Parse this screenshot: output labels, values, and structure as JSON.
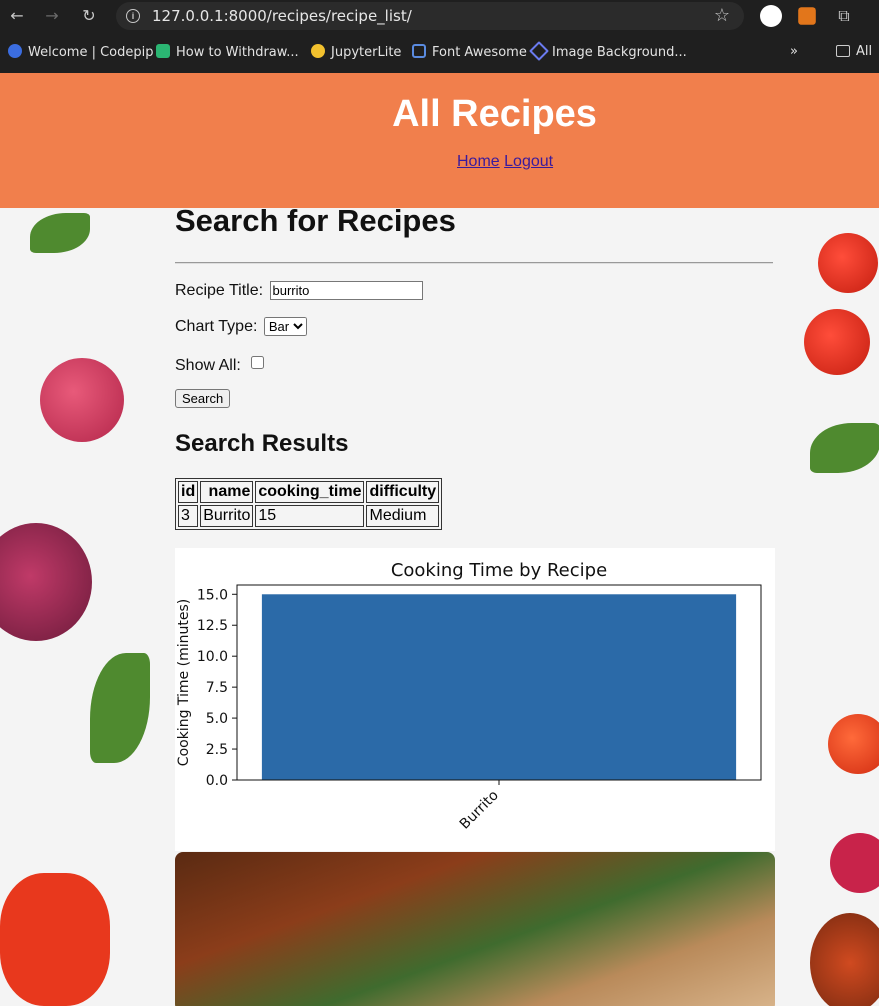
{
  "browser": {
    "url": "127.0.0.1:8000/recipes/recipe_list/",
    "bookmarks": [
      "Welcome | Codepip",
      "How to Withdraw...",
      "JupyterLite",
      "Font Awesome",
      "Image Background...",
      "All"
    ]
  },
  "header": {
    "title": "All Recipes",
    "home_link": "Home",
    "logout_link": "Logout"
  },
  "search": {
    "heading": "Search for Recipes",
    "title_label": "Recipe Title:",
    "title_value": "burrito",
    "chart_type_label": "Chart Type:",
    "chart_type_value": "Bar",
    "show_all_label": "Show All:",
    "button_label": "Search"
  },
  "results": {
    "heading": "Search Results",
    "columns": [
      "id",
      "name",
      "cooking_time",
      "difficulty"
    ],
    "rows": [
      [
        "3",
        "Burrito",
        "15",
        "Medium"
      ]
    ]
  },
  "chart_data": {
    "type": "bar",
    "title": "Cooking Time by Recipe",
    "ylabel": "Cooking Time (minutes)",
    "xlabel": "",
    "categories": [
      "Burrito"
    ],
    "values": [
      15
    ],
    "ylim": [
      0,
      15.75
    ],
    "yticks": [
      "0.0",
      "2.5",
      "5.0",
      "7.5",
      "10.0",
      "12.5",
      "15.0"
    ],
    "bar_color": "#2b6aa8",
    "grid": false
  },
  "colors": {
    "header_bg": "#f17f4c",
    "link": "#3a1a9c"
  }
}
